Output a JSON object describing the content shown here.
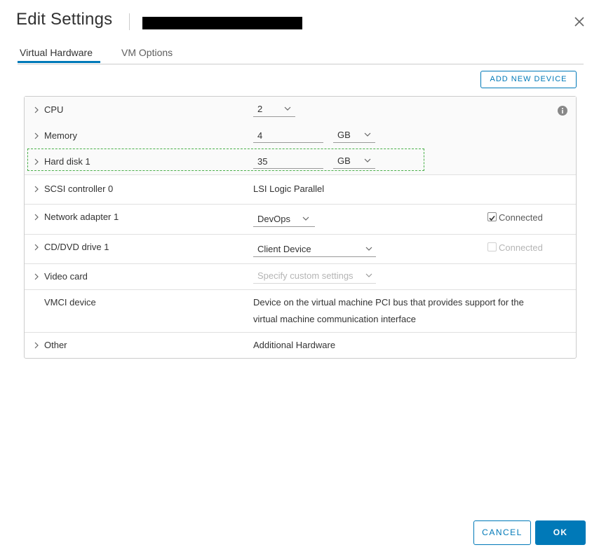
{
  "dialog": {
    "title": "Edit Settings"
  },
  "tabs": [
    {
      "label": "Virtual Hardware"
    },
    {
      "label": "VM Options"
    }
  ],
  "toolbar": {
    "add_device_label": "ADD NEW DEVICE"
  },
  "hardware": {
    "cpu": {
      "label": "CPU",
      "value": "2"
    },
    "memory": {
      "label": "Memory",
      "value": "4",
      "unit": "GB"
    },
    "hard_disk": {
      "label": "Hard disk 1",
      "value": "35",
      "unit": "GB"
    },
    "scsi": {
      "label": "SCSI controller 0",
      "value": "LSI Logic Parallel"
    },
    "network": {
      "label": "Network adapter 1",
      "value": "DevOps",
      "connected_label": "Connected",
      "connected": true
    },
    "cdvd": {
      "label": "CD/DVD drive 1",
      "value": "Client Device",
      "connected_label": "Connected",
      "connected": false
    },
    "video": {
      "label": "Video card",
      "value": "Specify custom settings"
    },
    "vmci": {
      "label": "VMCI device",
      "desc_line1": "Device on the virtual machine PCI bus that provides support for the",
      "desc_line2": "virtual machine communication interface"
    },
    "other": {
      "label": "Other",
      "value": "Additional Hardware"
    }
  },
  "footer": {
    "cancel_label": "CANCEL",
    "ok_label": "OK"
  },
  "colors": {
    "accent": "#0079b8",
    "focus_outline": "#4ab04a"
  }
}
